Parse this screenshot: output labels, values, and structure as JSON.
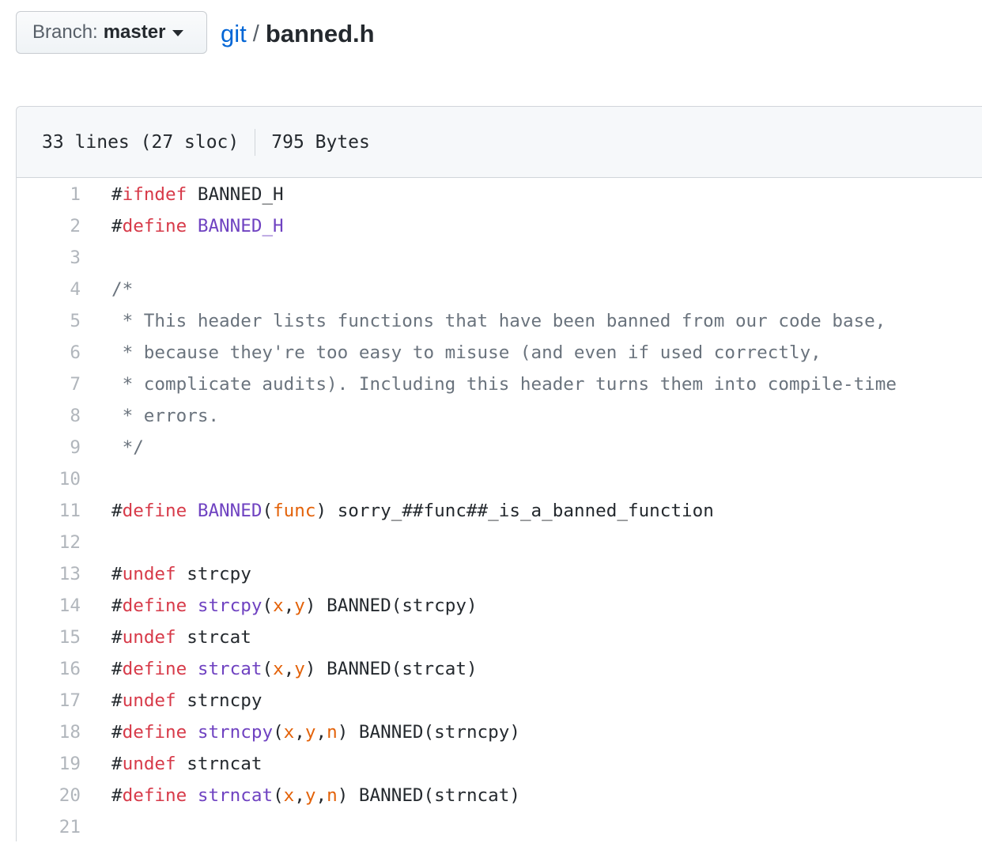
{
  "branch": {
    "prefix": "Branch:",
    "name": "master"
  },
  "breadcrumb": {
    "repo": "git",
    "separator": "/",
    "file": "banned.h"
  },
  "file_info": {
    "lines": "33 lines (27 sloc)",
    "size": "795 Bytes"
  },
  "colors": {
    "keyword": "#d73a49",
    "entity": "#6f42c1",
    "parameter": "#e36209",
    "comment": "#6a737d",
    "link": "#0366d6"
  },
  "code_lines": [
    {
      "num": "1",
      "tokens": [
        {
          "t": "#",
          "c": "pl"
        },
        {
          "t": "ifndef",
          "c": "kw"
        },
        {
          "t": " BANNED_H",
          "c": "pl"
        }
      ]
    },
    {
      "num": "2",
      "tokens": [
        {
          "t": "#",
          "c": "pl"
        },
        {
          "t": "define",
          "c": "kw"
        },
        {
          "t": " ",
          "c": "pl"
        },
        {
          "t": "BANNED_H",
          "c": "ent"
        }
      ]
    },
    {
      "num": "3",
      "tokens": []
    },
    {
      "num": "4",
      "tokens": [
        {
          "t": "/*",
          "c": "cm"
        }
      ]
    },
    {
      "num": "5",
      "tokens": [
        {
          "t": " * This header lists functions that have been banned from our code base,",
          "c": "cm"
        }
      ]
    },
    {
      "num": "6",
      "tokens": [
        {
          "t": " * because they're too easy to misuse (and even if used correctly,",
          "c": "cm"
        }
      ]
    },
    {
      "num": "7",
      "tokens": [
        {
          "t": " * complicate audits). Including this header turns them into compile-time",
          "c": "cm"
        }
      ]
    },
    {
      "num": "8",
      "tokens": [
        {
          "t": " * errors.",
          "c": "cm"
        }
      ]
    },
    {
      "num": "9",
      "tokens": [
        {
          "t": " */",
          "c": "cm"
        }
      ]
    },
    {
      "num": "10",
      "tokens": []
    },
    {
      "num": "11",
      "tokens": [
        {
          "t": "#",
          "c": "pl"
        },
        {
          "t": "define",
          "c": "kw"
        },
        {
          "t": " ",
          "c": "pl"
        },
        {
          "t": "BANNED",
          "c": "ent"
        },
        {
          "t": "(",
          "c": "pl"
        },
        {
          "t": "func",
          "c": "param"
        },
        {
          "t": ") sorry_##func##_is_a_banned_function",
          "c": "pl"
        }
      ]
    },
    {
      "num": "12",
      "tokens": []
    },
    {
      "num": "13",
      "tokens": [
        {
          "t": "#",
          "c": "pl"
        },
        {
          "t": "undef",
          "c": "kw"
        },
        {
          "t": " strcpy",
          "c": "pl"
        }
      ]
    },
    {
      "num": "14",
      "tokens": [
        {
          "t": "#",
          "c": "pl"
        },
        {
          "t": "define",
          "c": "kw"
        },
        {
          "t": " ",
          "c": "pl"
        },
        {
          "t": "strcpy",
          "c": "ent"
        },
        {
          "t": "(",
          "c": "pl"
        },
        {
          "t": "x",
          "c": "param"
        },
        {
          "t": ",",
          "c": "pl"
        },
        {
          "t": "y",
          "c": "param"
        },
        {
          "t": ") BANNED(strcpy)",
          "c": "pl"
        }
      ]
    },
    {
      "num": "15",
      "tokens": [
        {
          "t": "#",
          "c": "pl"
        },
        {
          "t": "undef",
          "c": "kw"
        },
        {
          "t": " strcat",
          "c": "pl"
        }
      ]
    },
    {
      "num": "16",
      "tokens": [
        {
          "t": "#",
          "c": "pl"
        },
        {
          "t": "define",
          "c": "kw"
        },
        {
          "t": " ",
          "c": "pl"
        },
        {
          "t": "strcat",
          "c": "ent"
        },
        {
          "t": "(",
          "c": "pl"
        },
        {
          "t": "x",
          "c": "param"
        },
        {
          "t": ",",
          "c": "pl"
        },
        {
          "t": "y",
          "c": "param"
        },
        {
          "t": ") BANNED(strcat)",
          "c": "pl"
        }
      ]
    },
    {
      "num": "17",
      "tokens": [
        {
          "t": "#",
          "c": "pl"
        },
        {
          "t": "undef",
          "c": "kw"
        },
        {
          "t": " strncpy",
          "c": "pl"
        }
      ]
    },
    {
      "num": "18",
      "tokens": [
        {
          "t": "#",
          "c": "pl"
        },
        {
          "t": "define",
          "c": "kw"
        },
        {
          "t": " ",
          "c": "pl"
        },
        {
          "t": "strncpy",
          "c": "ent"
        },
        {
          "t": "(",
          "c": "pl"
        },
        {
          "t": "x",
          "c": "param"
        },
        {
          "t": ",",
          "c": "pl"
        },
        {
          "t": "y",
          "c": "param"
        },
        {
          "t": ",",
          "c": "pl"
        },
        {
          "t": "n",
          "c": "param"
        },
        {
          "t": ") BANNED(strncpy)",
          "c": "pl"
        }
      ]
    },
    {
      "num": "19",
      "tokens": [
        {
          "t": "#",
          "c": "pl"
        },
        {
          "t": "undef",
          "c": "kw"
        },
        {
          "t": " strncat",
          "c": "pl"
        }
      ]
    },
    {
      "num": "20",
      "tokens": [
        {
          "t": "#",
          "c": "pl"
        },
        {
          "t": "define",
          "c": "kw"
        },
        {
          "t": " ",
          "c": "pl"
        },
        {
          "t": "strncat",
          "c": "ent"
        },
        {
          "t": "(",
          "c": "pl"
        },
        {
          "t": "x",
          "c": "param"
        },
        {
          "t": ",",
          "c": "pl"
        },
        {
          "t": "y",
          "c": "param"
        },
        {
          "t": ",",
          "c": "pl"
        },
        {
          "t": "n",
          "c": "param"
        },
        {
          "t": ") BANNED(strncat)",
          "c": "pl"
        }
      ]
    },
    {
      "num": "21",
      "tokens": []
    }
  ]
}
